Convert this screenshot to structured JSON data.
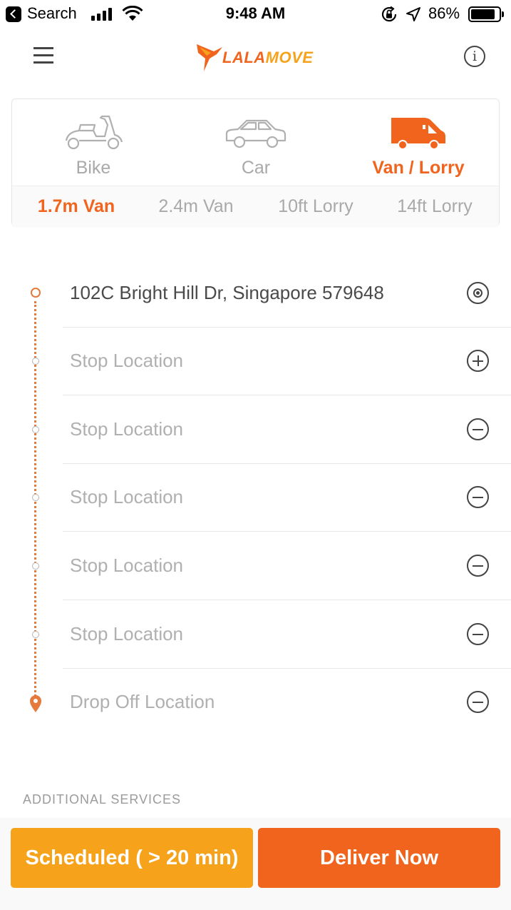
{
  "status_bar": {
    "back_app": "Search",
    "time": "9:48 AM",
    "battery_percent": "86%",
    "battery_level": 0.86
  },
  "header": {
    "logo_text_part1": "LALA",
    "logo_text_part2": "MOVE",
    "colors": {
      "brand_orange": "#f0641e",
      "brand_yellow": "#f7a21b"
    }
  },
  "vehicles": {
    "tabs": [
      {
        "label": "Bike",
        "icon": "scooter-icon",
        "active": false
      },
      {
        "label": "Car",
        "icon": "car-icon",
        "active": false
      },
      {
        "label": "Van / Lorry",
        "icon": "van-icon",
        "active": true
      }
    ],
    "subtypes": [
      {
        "label": "1.7m Van",
        "active": true
      },
      {
        "label": "2.4m Van",
        "active": false
      },
      {
        "label": "10ft Lorry",
        "active": false
      },
      {
        "label": "14ft Lorry",
        "active": false
      }
    ]
  },
  "route": {
    "stops": [
      {
        "text": "102C Bright Hill Dr, Singapore 579648",
        "kind": "pickup",
        "action": "current-location-icon"
      },
      {
        "text": "Stop Location",
        "kind": "stop",
        "action": "add-stop-icon"
      },
      {
        "text": "Stop Location",
        "kind": "stop",
        "action": "remove-stop-icon"
      },
      {
        "text": "Stop Location",
        "kind": "stop",
        "action": "remove-stop-icon"
      },
      {
        "text": "Stop Location",
        "kind": "stop",
        "action": "remove-stop-icon"
      },
      {
        "text": "Stop Location",
        "kind": "stop",
        "action": "remove-stop-icon"
      },
      {
        "text": "Drop Off Location",
        "kind": "dropoff",
        "action": "remove-stop-icon"
      }
    ]
  },
  "additional_services_heading": "ADDITIONAL SERVICES",
  "actions": {
    "scheduled_label": "Scheduled ( > 20 min)",
    "deliver_now_label": "Deliver Now"
  }
}
